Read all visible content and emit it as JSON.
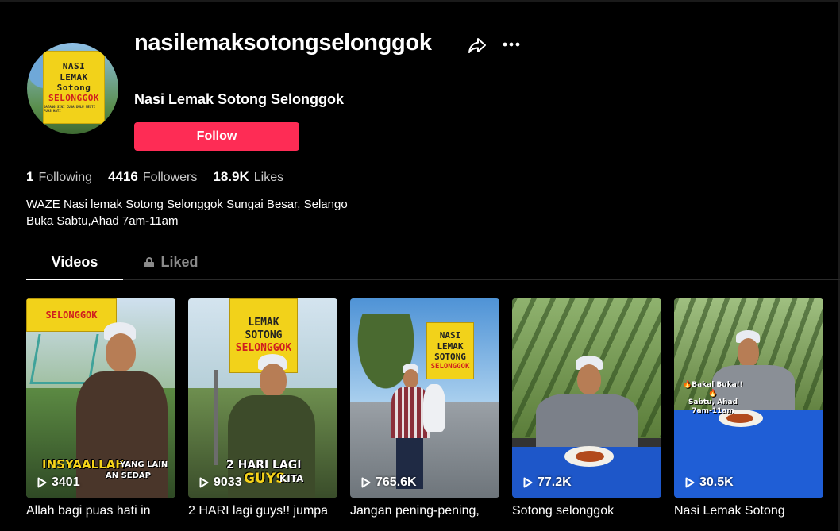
{
  "profile": {
    "username": "nasilemaksotongselonggok",
    "display_name": "Nasi Lemak Sotong Selonggok",
    "follow_label": "Follow",
    "avatar_sign": [
      "NASI",
      "LEMAK",
      "Sotong",
      "SELONGGOK"
    ],
    "avatar_sign_small": "DATANG SINI CUBA DULU MESTI PUAS HATI"
  },
  "stats": [
    {
      "value": "1",
      "label": "Following"
    },
    {
      "value": "4416",
      "label": "Followers"
    },
    {
      "value": "18.9K",
      "label": "Likes"
    }
  ],
  "bio": {
    "line1": "WAZE Nasi lemak Sotong Selonggok Sungai Besar, Selango",
    "line2": "Buka Sabtu,Ahad 7am-11am"
  },
  "tabs": [
    {
      "label": "Videos",
      "active": true
    },
    {
      "label": "Liked",
      "active": false,
      "icon": "lock-icon"
    }
  ],
  "videos": [
    {
      "views": "3401",
      "caption": "Allah bagi puas hati in",
      "overlay": "INSYAALLAH",
      "overlay2": "YANG LAIN",
      "overlay3": "AN SEDAP",
      "sign": "SELONGGOK"
    },
    {
      "views": "9033",
      "caption": "2 HARI lagi guys!! jumpa",
      "overlay": "2 HARI LAGI",
      "overlay2": "GUYS",
      "overlay3": "KITA",
      "sign_lines": [
        "LEMAK",
        "SOTONG",
        "SELONGGOK"
      ]
    },
    {
      "views": "765.6K",
      "caption": "Jangan pening-pening,",
      "sign_lines": [
        "NASI",
        "LEMAK",
        "SOTONG",
        "SELONGGOK"
      ]
    },
    {
      "views": "77.2K",
      "caption": "Sotong selonggok"
    },
    {
      "views": "30.5K",
      "caption": "Nasi Lemak Sotong",
      "overlay_lines": [
        "🔥Bakal Buka!!🔥",
        "Sabtu, Ahad",
        "7am-11am"
      ]
    }
  ],
  "colors": {
    "background": "#000000",
    "follow": "#fe2c55",
    "sign_yellow": "#f2d21a",
    "sign_red": "#d01f1f"
  }
}
